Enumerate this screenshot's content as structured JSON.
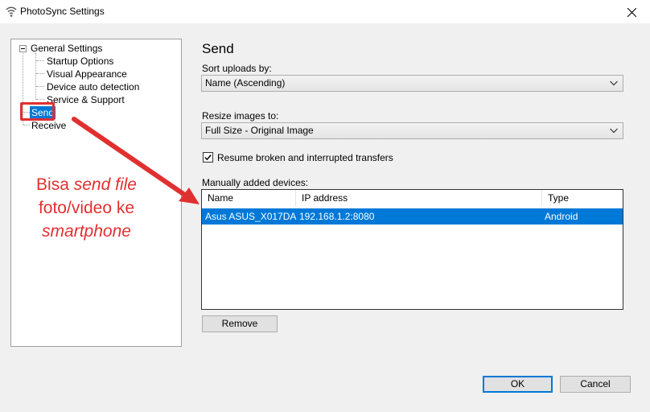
{
  "window": {
    "title": "PhotoSync Settings"
  },
  "tree": {
    "root_label": "General Settings",
    "children": [
      "Startup Options",
      "Visual Appearance",
      "Device auto detection",
      "Service & Support"
    ],
    "send_label": "Send",
    "receive_label": "Receive",
    "selected": "Send"
  },
  "send": {
    "title": "Send",
    "sort_label": "Sort uploads by:",
    "sort_value": "Name (Ascending)",
    "resize_label": "Resize images to:",
    "resize_value": "Full Size - Original Image",
    "resume_label": "Resume broken and interrupted transfers",
    "resume_checked": true,
    "devices_label": "Manually added devices:",
    "columns": {
      "name": "Name",
      "ip": "IP address",
      "type": "Type"
    },
    "devices": [
      {
        "name": "Asus ASUS_X017DA",
        "ip": "192.168.1.2:8080",
        "type": "Android",
        "selected": true
      }
    ],
    "remove_label": "Remove"
  },
  "buttons": {
    "ok": "OK",
    "cancel": "Cancel"
  },
  "annotation": {
    "line1_plain": "Bisa ",
    "line1_italic": "send file",
    "line2": "foto/video ke",
    "line3_italic": "smartphone",
    "color": "#e03030"
  },
  "colors": {
    "selection": "#0078d7",
    "annotation": "#e03030"
  }
}
